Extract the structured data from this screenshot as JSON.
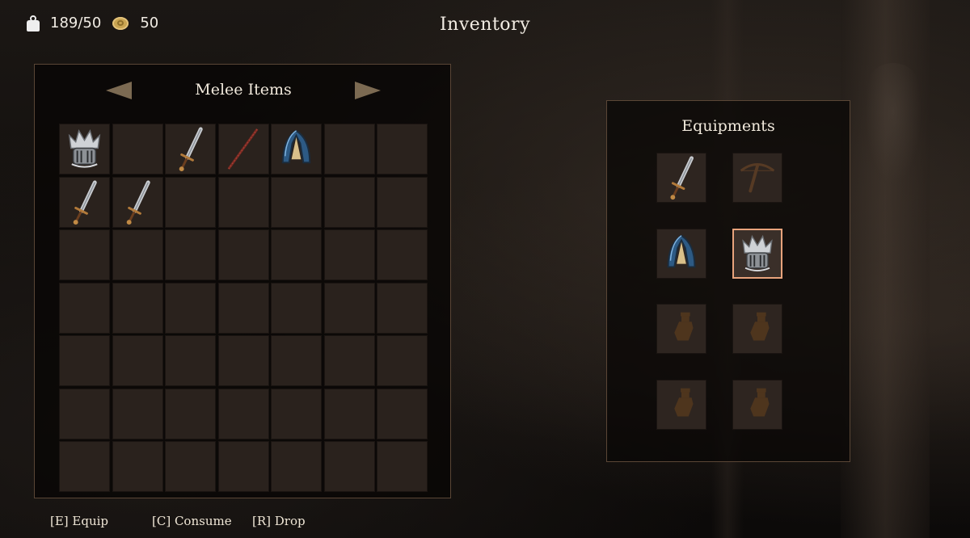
{
  "hud": {
    "weight": "189/50",
    "gold": "50"
  },
  "title": "Inventory",
  "inventory": {
    "category": "Melee Items",
    "columns": 7,
    "rows": 7,
    "items": [
      {
        "slot": 0,
        "icon": "helmet-spiked-icon"
      },
      {
        "slot": 2,
        "icon": "sword-icon"
      },
      {
        "slot": 3,
        "icon": "spear-icon"
      },
      {
        "slot": 4,
        "icon": "helmet-blue-icon"
      },
      {
        "slot": 7,
        "icon": "sword-icon"
      },
      {
        "slot": 8,
        "icon": "sword-icon"
      }
    ]
  },
  "equipment": {
    "title": "Equipments",
    "slots": [
      {
        "icon": "sword-icon",
        "empty": false
      },
      {
        "icon": "crossbow-icon",
        "empty": true
      },
      {
        "icon": "helmet-blue-icon",
        "empty": false
      },
      {
        "icon": "helmet-spiked-icon",
        "empty": false,
        "selected": true
      },
      {
        "icon": "potion-icon",
        "empty": true
      },
      {
        "icon": "potion-icon",
        "empty": true
      },
      {
        "icon": "potion-icon",
        "empty": true
      },
      {
        "icon": "potion-icon",
        "empty": true
      }
    ]
  },
  "hints": {
    "equip": "[E] Equip",
    "consume": "[C] Consume",
    "drop": "[R] Drop"
  },
  "colors": {
    "panel_border": "#5a4636",
    "slot": "#2a221d",
    "selected_border": "#e8a37c"
  }
}
